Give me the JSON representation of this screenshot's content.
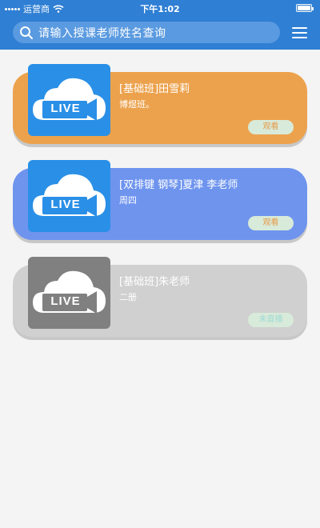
{
  "status_bar": {
    "carrier": "运营商",
    "time": "下午1:02"
  },
  "search": {
    "placeholder": "请输入授课老师姓名查询",
    "icon": "search-icon"
  },
  "menu": {
    "icon": "menu-icon"
  },
  "courses": [
    {
      "title": "[基础班]田雪莉",
      "subtitle": "博煜班。",
      "button": "观看",
      "thumb_label": "LIVE",
      "card_color": "#eca24d",
      "thumb_color": "#2a8fe6",
      "button_bg": "#d8ead9",
      "button_text_color": "#e69a49",
      "state": "live"
    },
    {
      "title": "[双排键 钢琴]夏津 李老师",
      "subtitle": "周四",
      "button": "观看",
      "thumb_label": "LIVE",
      "card_color": "#6e94ee",
      "thumb_color": "#2a8fe6",
      "button_bg": "#d8ead9",
      "button_text_color": "#e69a49",
      "state": "live"
    },
    {
      "title": "[基础班]朱老师",
      "subtitle": "二册",
      "button": "未直播",
      "thumb_label": "LIVE",
      "card_color": "#d0d0d0",
      "thumb_color": "#808080",
      "button_bg": "#d8ead9",
      "button_text_color": "#9fd9d6",
      "state": "not-live"
    }
  ]
}
